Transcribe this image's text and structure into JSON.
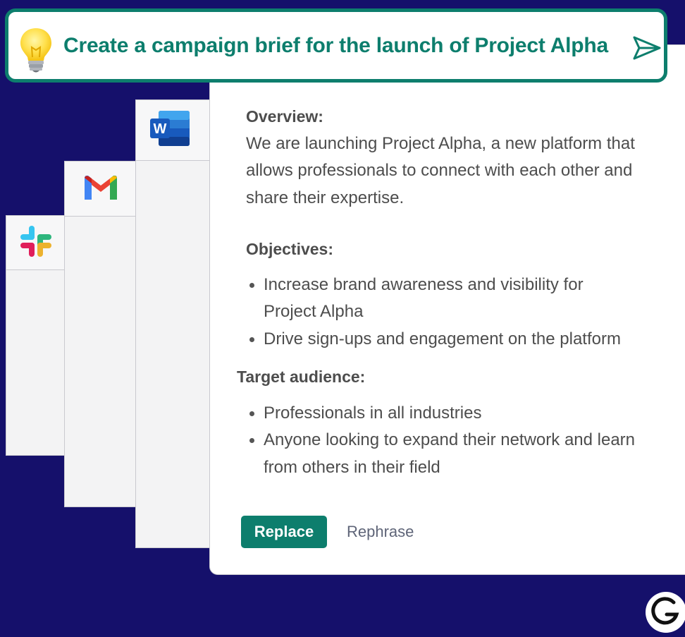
{
  "prompt": {
    "text": "Create a campaign brief for the launch of Project Alpha",
    "icon": "lightbulb-icon",
    "send_icon": "send-icon"
  },
  "apps": [
    {
      "name": "Slack",
      "icon": "slack-icon"
    },
    {
      "name": "Gmail",
      "icon": "gmail-icon"
    },
    {
      "name": "Word",
      "icon": "word-icon",
      "letter": "W"
    }
  ],
  "brief": {
    "overview_heading": "Overview:",
    "overview_text": "We are launching Project Alpha, a new platform that allows professionals to connect with each other and share their expertise.",
    "objectives_heading": "Objectives:",
    "objectives": [
      "Increase brand awareness and visibility for Project Alpha",
      "Drive sign-ups and engagement on the platform"
    ],
    "audience_heading": "Target audience:",
    "audience": [
      "Professionals in all industries",
      "Anyone looking to expand their network and learn from others in their field"
    ]
  },
  "actions": {
    "replace_label": "Replace",
    "rephrase_label": "Rephrase"
  },
  "colors": {
    "background": "#15106b",
    "accent": "#0d7e6d",
    "text": "#4d4d4d"
  },
  "brand_logo": "grammarly-g-icon"
}
